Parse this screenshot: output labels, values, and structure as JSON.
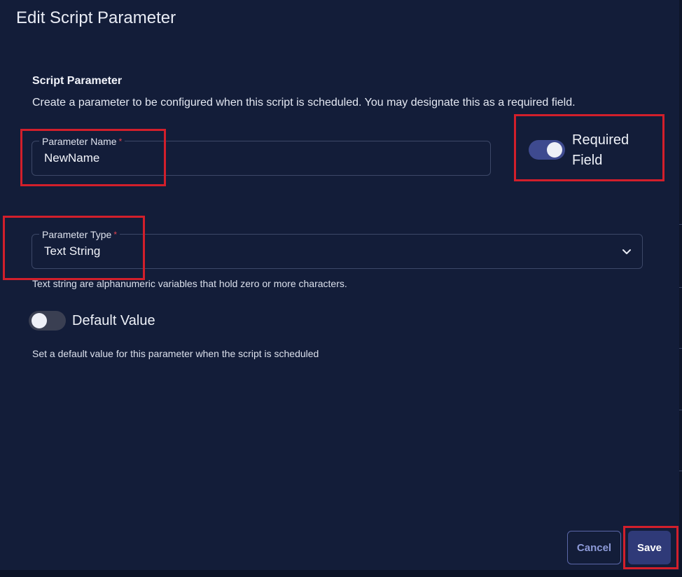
{
  "dialog": {
    "title": "Edit Script Parameter"
  },
  "section": {
    "title": "Script Parameter",
    "description": "Create a parameter to be configured when this script is scheduled. You may designate this as a required field."
  },
  "parameter_name": {
    "label": "Parameter Name",
    "required_marker": "*",
    "value": "NewName"
  },
  "required_field": {
    "label": "Required Field",
    "enabled": true
  },
  "parameter_type": {
    "label": "Parameter Type",
    "required_marker": "*",
    "value": "Text String",
    "helper": "Text string are alphanumeric variables that hold zero or more characters."
  },
  "default_value": {
    "label": "Default Value",
    "enabled": false,
    "helper": "Set a default value for this parameter when the script is scheduled"
  },
  "actions": {
    "cancel_label": "Cancel",
    "save_label": "Save"
  },
  "colors": {
    "background": "#131d39",
    "accent": "#3e4a8f",
    "highlight": "#d21f2b",
    "required_star": "#e0424f"
  },
  "icons": {
    "select_chevron": "chevron-down-icon"
  }
}
